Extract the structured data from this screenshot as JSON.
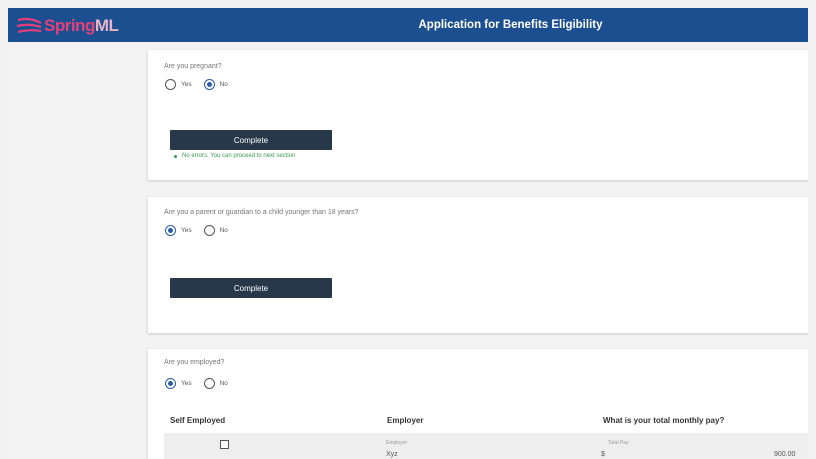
{
  "header": {
    "logo_prefix": "Spring",
    "logo_suffix": "ML",
    "title": "Application for Benefits Eligibility"
  },
  "colors": {
    "header_bg": "#1b4f8f",
    "button_bg": "#26384a",
    "success": "#3c9a55",
    "radio_selected": "#2a5da5"
  },
  "section_pregnant": {
    "question": "Are you pregnant?",
    "options": [
      {
        "label": "Yes",
        "selected": false
      },
      {
        "label": "No",
        "selected": true
      }
    ],
    "complete_label": "Complete",
    "success_message": "No errors. You can proceed to next section"
  },
  "section_guardian": {
    "question": "Are you a parent or guardian to a child younger than 18 years?",
    "options": [
      {
        "label": "Yes",
        "selected": true
      },
      {
        "label": "No",
        "selected": false
      }
    ],
    "complete_label": "Complete"
  },
  "section_employed": {
    "question": "Are you employed?",
    "options": [
      {
        "label": "Yes",
        "selected": true
      },
      {
        "label": "No",
        "selected": false
      }
    ],
    "columns": [
      "Self Employed",
      "Employer",
      "What is your total monthly pay?"
    ],
    "row": {
      "self_employed_checked": false,
      "employer_label": "Employer",
      "employer_value": "Xyz",
      "pay_label": "Total Pay",
      "pay_prefix": "$",
      "pay_value": "900.00"
    }
  }
}
